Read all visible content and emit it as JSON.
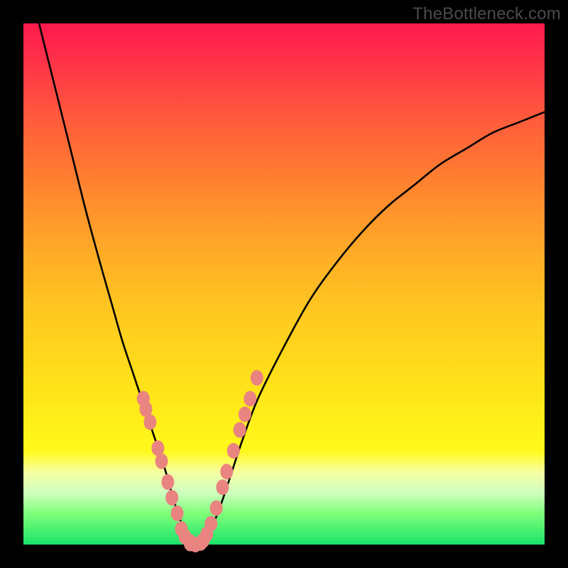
{
  "watermark": "TheBottleneck.com",
  "colors": {
    "curve": "#000000",
    "markers": "#e98480",
    "bg_top": "#ff1a4c",
    "bg_bottom": "#19e36a",
    "frame": "#000000"
  },
  "chart_data": {
    "type": "line",
    "title": "",
    "xlabel": "",
    "ylabel": "",
    "xlim": [
      0,
      100
    ],
    "ylim": [
      0,
      100
    ],
    "series": [
      {
        "name": "bottleneck-curve",
        "x": [
          3,
          6,
          9,
          12,
          15,
          17,
          19,
          21,
          23,
          25,
          27,
          29,
          30,
          31,
          32,
          33,
          34,
          36,
          38,
          40,
          42,
          45,
          50,
          55,
          60,
          65,
          70,
          75,
          80,
          85,
          90,
          95,
          100
        ],
        "y": [
          100,
          88,
          76,
          64,
          53,
          46,
          39,
          33,
          27,
          21,
          15,
          8,
          5,
          2,
          0,
          0,
          0,
          3,
          8,
          14,
          20,
          28,
          38,
          47,
          54,
          60,
          65,
          69,
          73,
          76,
          79,
          81,
          83
        ]
      }
    ],
    "markers_left": {
      "name": "left-cluster",
      "x": [
        23.0,
        23.5,
        24.3,
        25.8,
        26.5,
        27.7,
        28.5,
        29.5,
        30.3,
        31.0,
        32.0
      ],
      "y": [
        28.0,
        26.0,
        23.5,
        18.5,
        16.0,
        12.0,
        9.0,
        6.0,
        3.0,
        1.5,
        0.5
      ]
    },
    "markers_right": {
      "name": "right-cluster",
      "x": [
        34.5,
        35.2,
        36.0,
        37.0,
        38.2,
        39.0,
        40.3,
        41.5,
        42.5,
        43.5,
        44.8
      ],
      "y": [
        0.8,
        2.0,
        4.0,
        7.0,
        11.0,
        14.0,
        18.0,
        22.0,
        25.0,
        28.0,
        32.0
      ]
    },
    "markers_bottom": {
      "name": "valley-cluster",
      "x": [
        32.0,
        33.0,
        34.0
      ],
      "y": [
        0.2,
        0.0,
        0.3
      ]
    }
  }
}
